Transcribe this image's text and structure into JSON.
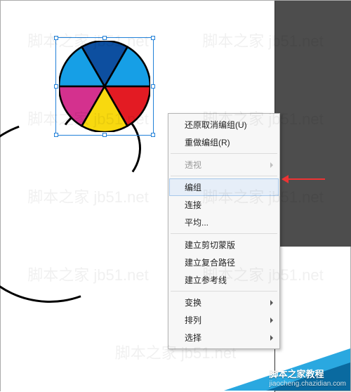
{
  "watermark_text": "脚本之家 jb51.net",
  "badge": {
    "line1": "脚本之家教程",
    "line2": "jiaocheng.chazidian.com"
  },
  "selection": {
    "object": "pie-graphic",
    "handles": [
      "nw",
      "n",
      "ne",
      "w",
      "e",
      "sw",
      "s",
      "se"
    ]
  },
  "pie": {
    "colors": [
      "#169fe6",
      "#e31b23",
      "#f8d90f",
      "#d4318e",
      "#0d4fa0",
      "#169fe6"
    ],
    "stroke": "#000"
  },
  "arrow": {
    "color": "#e33",
    "points_to": "menu.items.3"
  },
  "menu": {
    "items": [
      {
        "label": "还原取消编组(U)",
        "enabled": true,
        "submenu": false
      },
      {
        "label": "重做编组(R)",
        "enabled": true,
        "submenu": false
      },
      {
        "label": "透视",
        "enabled": false,
        "submenu": true
      },
      {
        "label": "编组",
        "enabled": true,
        "submenu": false,
        "highlighted": true
      },
      {
        "label": "连接",
        "enabled": true,
        "submenu": false
      },
      {
        "label": "平均...",
        "enabled": true,
        "submenu": false
      },
      {
        "label": "建立剪切蒙版",
        "enabled": true,
        "submenu": false
      },
      {
        "label": "建立复合路径",
        "enabled": true,
        "submenu": false
      },
      {
        "label": "建立参考线",
        "enabled": true,
        "submenu": false
      },
      {
        "label": "变换",
        "enabled": true,
        "submenu": true
      },
      {
        "label": "排列",
        "enabled": true,
        "submenu": true
      },
      {
        "label": "选择",
        "enabled": true,
        "submenu": true
      }
    ],
    "separators_after": [
      1,
      2,
      5,
      8
    ]
  }
}
